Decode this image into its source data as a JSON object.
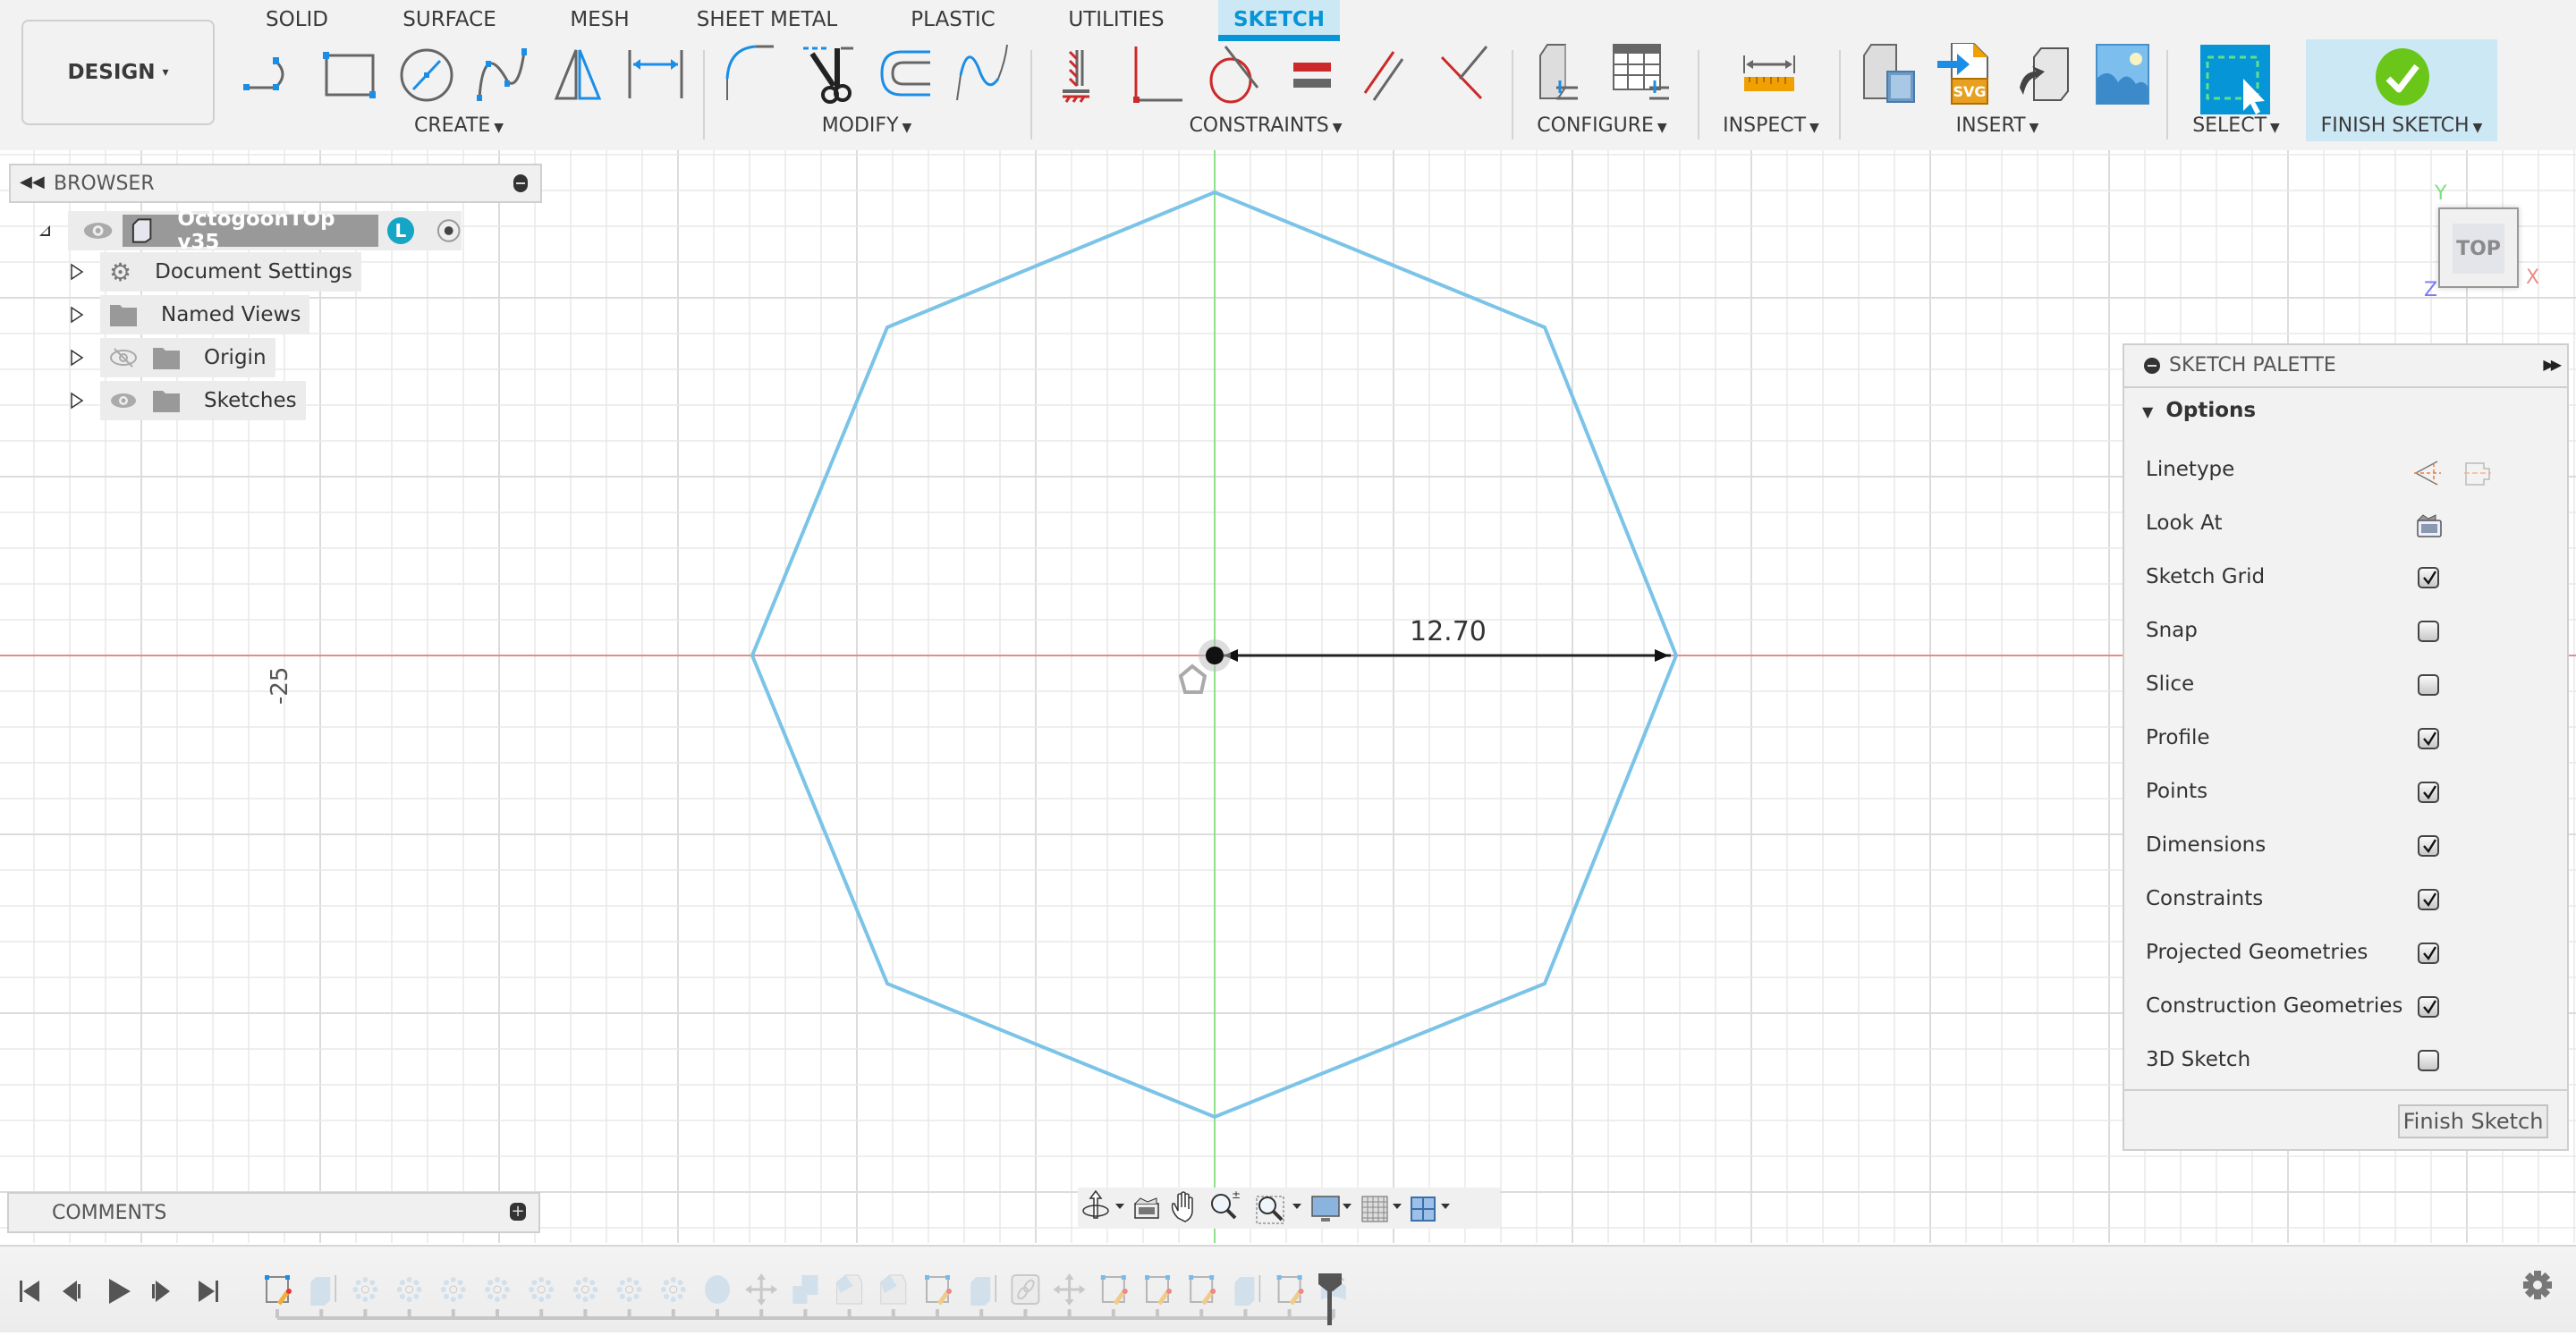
{
  "workspace": {
    "label": "DESIGN",
    "caret": "▾"
  },
  "tabs": [
    {
      "label": "SOLID",
      "active": false
    },
    {
      "label": "SURFACE",
      "active": false
    },
    {
      "label": "MESH",
      "active": false
    },
    {
      "label": "SHEET METAL",
      "active": false
    },
    {
      "label": "PLASTIC",
      "active": false
    },
    {
      "label": "UTILITIES",
      "active": false
    },
    {
      "label": "SKETCH",
      "active": true
    }
  ],
  "groups": {
    "create": {
      "label": "CREATE",
      "tools": [
        "line-icon",
        "rectangle-icon",
        "circle-icon",
        "spline-icon",
        "mirror-icon",
        "dimension-icon"
      ]
    },
    "modify": {
      "label": "MODIFY",
      "tools": [
        "fillet-icon",
        "trim-icon",
        "offset-icon",
        "extend-curve-icon"
      ]
    },
    "constraints": {
      "label": "CONSTRAINTS",
      "tools": [
        "fix-constraint-icon",
        "perpendicular-icon",
        "tangent-icon",
        "equal-icon",
        "parallel-icon",
        "intersect-icon"
      ]
    },
    "configure": {
      "label": "CONFIGURE",
      "tools": [
        "parameters-icon",
        "table-icon"
      ]
    },
    "inspect": {
      "label": "INSPECT",
      "tools": [
        "measure-icon"
      ]
    },
    "insert": {
      "label": "INSERT",
      "tools": [
        "insert-dxf-icon",
        "insert-svg-icon",
        "insert-mesh-icon",
        "canvas-icon"
      ]
    },
    "select": {
      "label": "SELECT",
      "tools": [
        "select-window-icon"
      ]
    },
    "finish": {
      "label": "FINISH SKETCH",
      "tools": [
        "checkmark-icon"
      ]
    }
  },
  "browser": {
    "title": "BROWSER",
    "root": {
      "label": "OctogoonTOp v35",
      "badge": "L"
    },
    "items": [
      {
        "label": "Document Settings",
        "icon": "gear-icon"
      },
      {
        "label": "Named Views",
        "icon": "folder-icon"
      },
      {
        "label": "Origin",
        "icon": "folder-icon",
        "visibility": "hidden"
      },
      {
        "label": "Sketches",
        "icon": "folder-icon",
        "visibility": "visible"
      }
    ]
  },
  "canvas": {
    "dimension": "12.70",
    "axis_label": "-25",
    "viewcube": {
      "face": "TOP",
      "x": "X",
      "y": "Y",
      "z": "Z"
    },
    "colors": {
      "sketch_line": "#7cc3e8",
      "x_axis": "#e88a8a",
      "y_axis": "#8fe08a",
      "grid": "#e8e8e8"
    }
  },
  "comments": {
    "title": "COMMENTS"
  },
  "palette": {
    "title": "SKETCH PALETTE",
    "section": "Options",
    "options": [
      {
        "label": "Linetype",
        "type": "icons"
      },
      {
        "label": "Look At",
        "type": "icon"
      },
      {
        "label": "Sketch Grid",
        "type": "checkbox",
        "checked": true
      },
      {
        "label": "Snap",
        "type": "checkbox",
        "checked": false
      },
      {
        "label": "Slice",
        "type": "checkbox",
        "checked": false
      },
      {
        "label": "Profile",
        "type": "checkbox",
        "checked": true
      },
      {
        "label": "Points",
        "type": "checkbox",
        "checked": true
      },
      {
        "label": "Dimensions",
        "type": "checkbox",
        "checked": true
      },
      {
        "label": "Constraints",
        "type": "checkbox",
        "checked": true
      },
      {
        "label": "Projected Geometries",
        "type": "checkbox",
        "checked": true
      },
      {
        "label": "Construction Geometries",
        "type": "checkbox",
        "checked": true
      },
      {
        "label": "3D Sketch",
        "type": "checkbox",
        "checked": false
      }
    ],
    "finish_button": "Finish Sketch"
  },
  "navbar": {
    "tools": [
      "orbit-icon",
      "look-at-icon",
      "pan-icon",
      "zoom-icon",
      "zoom-window-icon",
      "display-settings-icon",
      "grid-settings-icon",
      "viewports-icon"
    ]
  },
  "timeline": {
    "controls": [
      "skip-start-icon",
      "step-back-icon",
      "play-icon",
      "step-forward-icon",
      "skip-end-icon"
    ],
    "features": [
      "sketch",
      "extrude",
      "pattern",
      "pattern",
      "pattern",
      "pattern",
      "pattern",
      "pattern",
      "pattern",
      "pattern",
      "sphere",
      "move",
      "combine",
      "chamfer",
      "chamfer",
      "sketch",
      "extrude",
      "joint",
      "move",
      "sketch",
      "sketch",
      "sketch",
      "extrude",
      "sketch",
      "revolve"
    ]
  }
}
